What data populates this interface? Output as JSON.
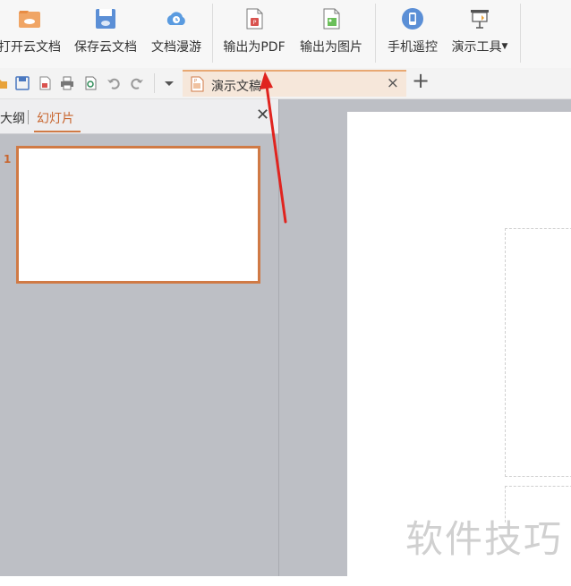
{
  "toolbar": {
    "open_cloud": "打开云文档",
    "save_cloud": "保存云文档",
    "doc_roam": "文档漫游",
    "export_pdf": "输出为PDF",
    "export_image": "输出为图片",
    "phone_remote": "手机遥控",
    "present_tools": "演示工具"
  },
  "tabs": {
    "doc_tab": "演示文稿"
  },
  "panel": {
    "outline_tab": "大纲",
    "slides_tab": "幻灯片",
    "slide_number": "1"
  },
  "watermark": "软件技巧",
  "colors": {
    "accent": "#d07a45",
    "arrow": "#e0241f"
  }
}
